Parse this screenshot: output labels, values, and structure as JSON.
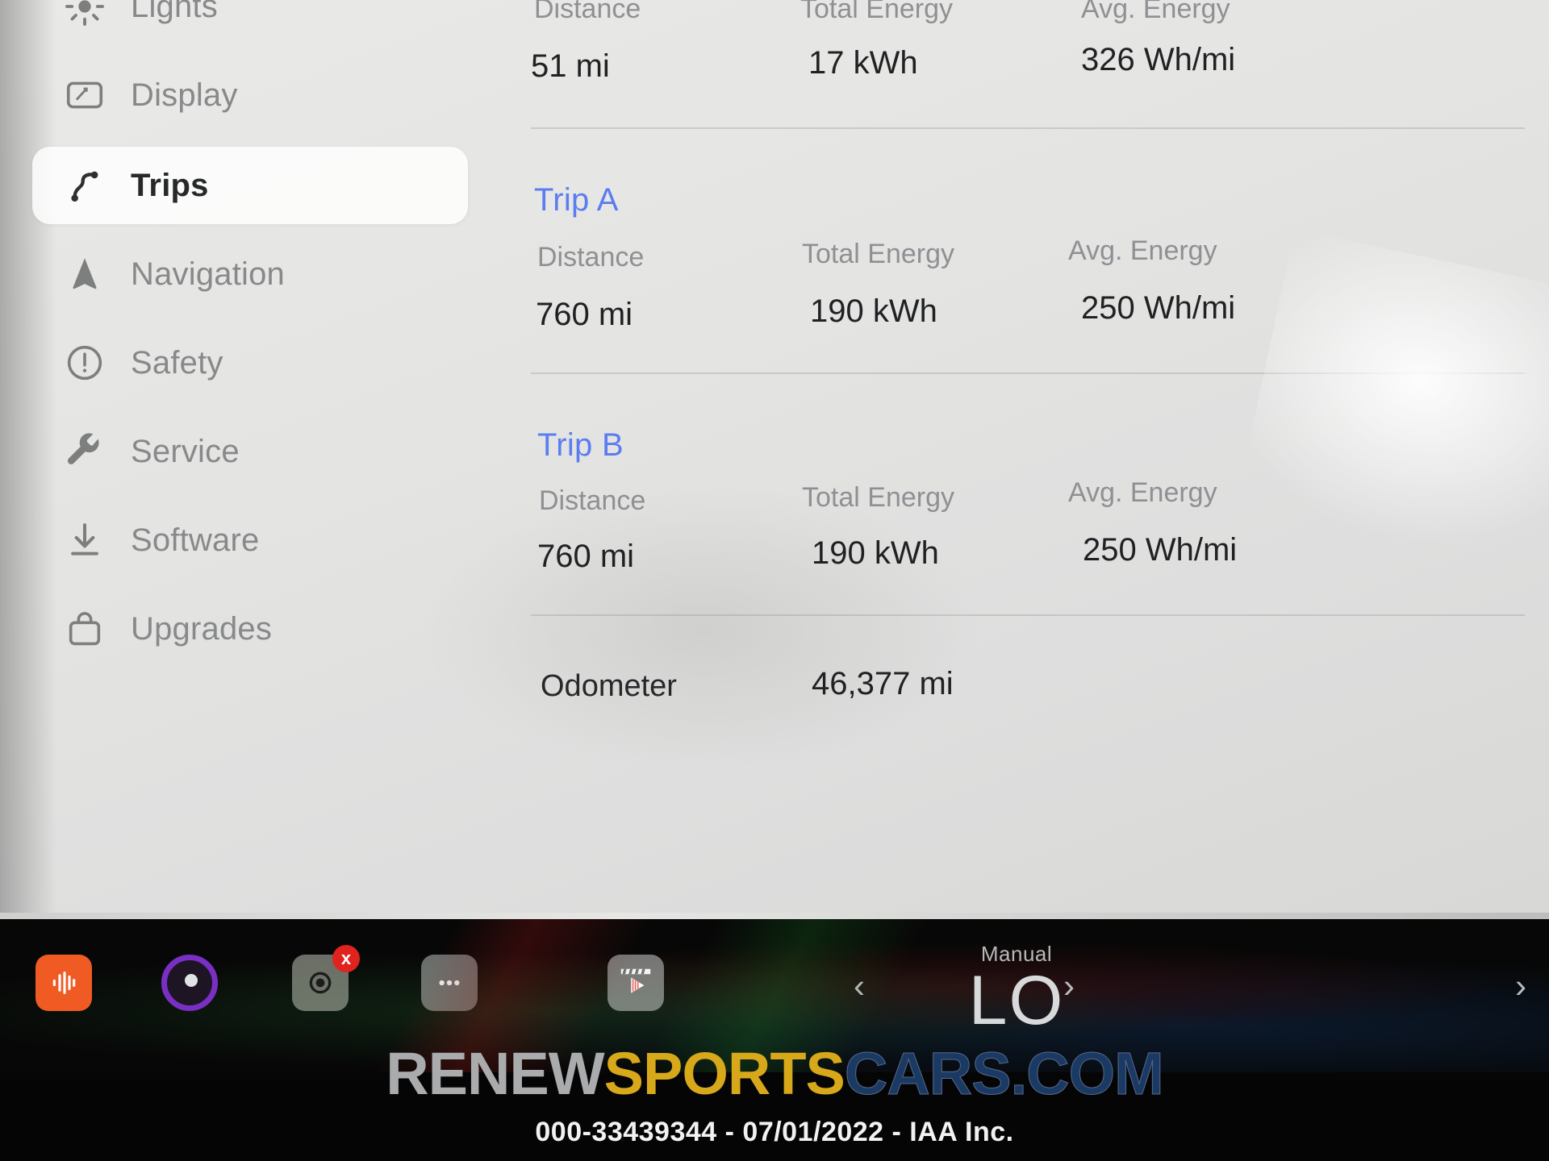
{
  "sidebar": {
    "items": [
      {
        "label": "Lights",
        "icon": "sun-icon",
        "active": false
      },
      {
        "label": "Display",
        "icon": "display-icon",
        "active": false
      },
      {
        "label": "Trips",
        "icon": "trips-icon",
        "active": true
      },
      {
        "label": "Navigation",
        "icon": "navigation-icon",
        "active": false
      },
      {
        "label": "Safety",
        "icon": "warning-icon",
        "active": false
      },
      {
        "label": "Service",
        "icon": "wrench-icon",
        "active": false
      },
      {
        "label": "Software",
        "icon": "download-icon",
        "active": false
      },
      {
        "label": "Upgrades",
        "icon": "bag-icon",
        "active": false
      }
    ]
  },
  "trips": {
    "column_headers": {
      "distance": "Distance",
      "total_energy": "Total Energy",
      "avg_energy": "Avg. Energy"
    },
    "current": {
      "distance": "51 mi",
      "total_energy": "17 kWh",
      "avg_energy": "326 Wh/mi"
    },
    "trip_a": {
      "title": "Trip A",
      "distance": "760 mi",
      "total_energy": "190 kWh",
      "avg_energy": "250 Wh/mi"
    },
    "trip_b": {
      "title": "Trip B",
      "distance": "760 mi",
      "total_energy": "190 kWh",
      "avg_energy": "250 Wh/mi"
    },
    "odometer": {
      "label": "Odometer",
      "value": "46,377 mi"
    },
    "link_color": "#5b7df0"
  },
  "dock": {
    "icons": [
      {
        "name": "audio-icon",
        "badge": ""
      },
      {
        "name": "spotify-icon",
        "badge": ""
      },
      {
        "name": "dashcam-icon",
        "badge": "x"
      },
      {
        "name": "more-icon",
        "badge": ""
      },
      {
        "name": "theater-icon",
        "badge": ""
      }
    ],
    "prev_label": "‹",
    "next_label": "›",
    "climate": {
      "mode": "Manual",
      "temperature": "LO"
    }
  },
  "watermark": {
    "part1": "RENEW",
    "part2": "SPORTS",
    "part3": "CARS.COM"
  },
  "footer": {
    "text": "000-33439344 - 07/01/2022 - IAA Inc."
  }
}
